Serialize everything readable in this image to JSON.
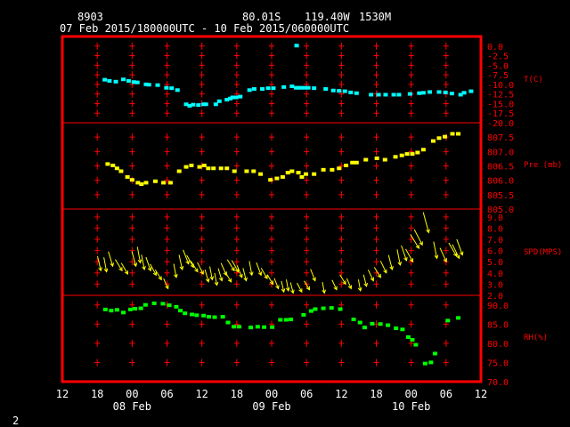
{
  "header": {
    "station": "8903",
    "lat": "80.01S",
    "lon": "119.40W",
    "elev": "1530M",
    "period": "07 Feb 2015/180000UTC - 10 Feb 2015/060000UTC"
  },
  "footer": {
    "page": "2"
  },
  "colors": {
    "frame": "#ff0000",
    "temp": "#00ffff",
    "pres": "#ffff00",
    "wind": "#ffff00",
    "rh": "#00ff00",
    "text": "#ffffff"
  },
  "chart_data": {
    "type": "scatter",
    "x_axis": {
      "unit": "hours since 08 Feb 00 UTC",
      "range": [
        -12,
        60
      ],
      "ticks": [
        -12,
        -6,
        0,
        6,
        12,
        18,
        24,
        30,
        36,
        42,
        48,
        54,
        60
      ],
      "tick_labels": [
        "12",
        "18",
        "00",
        "06",
        "12",
        "18",
        "00",
        "06",
        "12",
        "18",
        "00",
        "06",
        "12"
      ],
      "date_labels": [
        {
          "at": 0,
          "text": "08 Feb"
        },
        {
          "at": 24,
          "text": "09 Feb"
        },
        {
          "at": 48,
          "text": "10 Feb"
        }
      ]
    },
    "panels": [
      {
        "name": "T(C)",
        "type": "scatter",
        "range": [
          -20,
          2.5
        ],
        "ticks": [
          0,
          -2.5,
          -5,
          -7.5,
          -10,
          -12.5,
          -15,
          -17.5,
          -20
        ],
        "tick_labels": [
          "0.0",
          "-2.5",
          "-5.0",
          "-7.5",
          "-10.0",
          "-12.5",
          "-15.0",
          "-17.5",
          "-20.0"
        ],
        "points": [
          [
            -4.7,
            -8.9
          ],
          [
            -3.9,
            -9.2
          ],
          [
            -2.8,
            -9.4
          ],
          [
            -1.5,
            -8.8
          ],
          [
            -0.6,
            -9.2
          ],
          [
            0.3,
            -9.5
          ],
          [
            0.9,
            -9.6
          ],
          [
            2.4,
            -10.1
          ],
          [
            2.9,
            -10.2
          ],
          [
            4.4,
            -10.3
          ],
          [
            5.9,
            -11.0
          ],
          [
            6.8,
            -11.1
          ],
          [
            7.8,
            -11.6
          ],
          [
            9.3,
            -15.3
          ],
          [
            9.9,
            -15.7
          ],
          [
            10.5,
            -15.4
          ],
          [
            11.4,
            -15.5
          ],
          [
            12.3,
            -15.3
          ],
          [
            12.7,
            -15.3
          ],
          [
            14.4,
            -15.3
          ],
          [
            15.0,
            -14.5
          ],
          [
            16.3,
            -14.1
          ],
          [
            16.9,
            -13.8
          ],
          [
            17.3,
            -13.5
          ],
          [
            17.9,
            -13.5
          ],
          [
            18.6,
            -13.3
          ],
          [
            20.2,
            -11.6
          ],
          [
            21.0,
            -11.3
          ],
          [
            22.4,
            -11.3
          ],
          [
            23.4,
            -11.1
          ],
          [
            24.3,
            -11.1
          ],
          [
            26.1,
            -10.8
          ],
          [
            27.5,
            -10.6
          ],
          [
            28.2,
            -11.0
          ],
          [
            28.6,
            -11.0
          ],
          [
            29.1,
            -11.0
          ],
          [
            29.7,
            -11.0
          ],
          [
            30.3,
            -11.0
          ],
          [
            31.3,
            -11.1
          ],
          [
            33.3,
            -11.3
          ],
          [
            34.6,
            -11.7
          ],
          [
            35.6,
            -11.8
          ],
          [
            36.6,
            -11.9
          ],
          [
            37.6,
            -12.2
          ],
          [
            38.6,
            -12.4
          ],
          [
            41.1,
            -12.8
          ],
          [
            42.4,
            -12.8
          ],
          [
            43.6,
            -12.8
          ],
          [
            45.0,
            -12.8
          ],
          [
            45.9,
            -12.8
          ],
          [
            47.8,
            -12.6
          ],
          [
            49.4,
            -12.4
          ],
          [
            50.1,
            -12.3
          ],
          [
            51.2,
            -12.1
          ],
          [
            52.8,
            -12.1
          ],
          [
            53.9,
            -12.2
          ],
          [
            55.0,
            -12.5
          ],
          [
            56.5,
            -12.8
          ],
          [
            57.1,
            -12.3
          ],
          [
            58.3,
            -11.9
          ],
          [
            28.3,
            0.0
          ]
        ]
      },
      {
        "name": "Pre (mb)",
        "type": "scatter",
        "range": [
          805,
          808
        ],
        "ticks": [
          807.5,
          807,
          806.5,
          806,
          805.5,
          805
        ],
        "tick_labels": [
          "807.5",
          "807.0",
          "806.5",
          "806.0",
          "805.5",
          "805.0"
        ],
        "points": [
          [
            -4.2,
            806.55
          ],
          [
            -3.3,
            806.5
          ],
          [
            -2.6,
            806.4
          ],
          [
            -1.9,
            806.3
          ],
          [
            -0.8,
            806.1
          ],
          [
            0.0,
            806.0
          ],
          [
            1.0,
            805.9
          ],
          [
            1.6,
            805.85
          ],
          [
            2.4,
            805.9
          ],
          [
            4.0,
            805.95
          ],
          [
            5.4,
            805.9
          ],
          [
            6.6,
            805.9
          ],
          [
            8.1,
            806.3
          ],
          [
            9.3,
            806.45
          ],
          [
            10.2,
            806.5
          ],
          [
            11.6,
            806.45
          ],
          [
            12.4,
            806.5
          ],
          [
            13.1,
            806.4
          ],
          [
            14.0,
            806.4
          ],
          [
            15.3,
            806.4
          ],
          [
            16.3,
            806.4
          ],
          [
            17.6,
            806.3
          ],
          [
            19.7,
            806.3
          ],
          [
            20.9,
            806.3
          ],
          [
            22.1,
            806.2
          ],
          [
            23.8,
            806.0
          ],
          [
            24.9,
            806.05
          ],
          [
            25.9,
            806.1
          ],
          [
            26.8,
            806.25
          ],
          [
            27.5,
            806.3
          ],
          [
            28.6,
            806.25
          ],
          [
            29.2,
            806.1
          ],
          [
            29.9,
            806.2
          ],
          [
            31.3,
            806.2
          ],
          [
            32.9,
            806.35
          ],
          [
            34.4,
            806.35
          ],
          [
            35.6,
            806.4
          ],
          [
            36.8,
            806.5
          ],
          [
            37.9,
            806.6
          ],
          [
            38.6,
            806.6
          ],
          [
            40.2,
            806.7
          ],
          [
            42.1,
            806.75
          ],
          [
            43.5,
            806.7
          ],
          [
            45.3,
            806.8
          ],
          [
            46.4,
            806.85
          ],
          [
            47.3,
            806.9
          ],
          [
            48.2,
            806.9
          ],
          [
            49.1,
            806.95
          ],
          [
            50.1,
            807.05
          ],
          [
            51.8,
            807.35
          ],
          [
            52.8,
            807.45
          ],
          [
            53.8,
            807.5
          ],
          [
            55.1,
            807.6
          ],
          [
            56.1,
            807.6
          ]
        ]
      },
      {
        "name": "SPD(MPS)",
        "type": "wind_arrows",
        "range": [
          2,
          9.7
        ],
        "ticks": [
          9,
          8,
          7,
          6,
          5,
          4,
          3,
          2
        ],
        "tick_labels": [
          "9.0",
          "8.0",
          "7.0",
          "6.0",
          "5.0",
          "4.0",
          "3.0",
          "2.0"
        ],
        "points": [
          [
            -5.5,
            4.2
          ],
          [
            -4.5,
            4.1
          ],
          [
            -3.5,
            4.6
          ],
          [
            -2.0,
            4.2
          ],
          [
            -1.0,
            3.9
          ],
          [
            0.5,
            4.6
          ],
          [
            1.3,
            4.9
          ],
          [
            2.0,
            4.3
          ],
          [
            3.0,
            4.2
          ],
          [
            3.9,
            3.8
          ],
          [
            4.8,
            3.4
          ],
          [
            6.0,
            2.6
          ],
          [
            7.5,
            3.6
          ],
          [
            8.5,
            4.3
          ],
          [
            9.5,
            4.8
          ],
          [
            10.3,
            4.5
          ],
          [
            11.0,
            4.1
          ],
          [
            12.0,
            3.9
          ],
          [
            13.0,
            3.2
          ],
          [
            13.7,
            3.4
          ],
          [
            14.5,
            2.9
          ],
          [
            15.3,
            3.3
          ],
          [
            16.0,
            3.8
          ],
          [
            16.8,
            3.2
          ],
          [
            17.3,
            4.2
          ],
          [
            18.0,
            4.1
          ],
          [
            18.7,
            3.6
          ],
          [
            19.5,
            3.3
          ],
          [
            20.5,
            3.8
          ],
          [
            22.0,
            3.8
          ],
          [
            23.0,
            3.5
          ],
          [
            24.0,
            3.0
          ],
          [
            25.0,
            2.6
          ],
          [
            26.0,
            2.3
          ],
          [
            26.8,
            2.4
          ],
          [
            27.6,
            2.2
          ],
          [
            29.0,
            2.3
          ],
          [
            30.3,
            2.5
          ],
          [
            31.3,
            3.3
          ],
          [
            33.0,
            2.2
          ],
          [
            35.0,
            2.5
          ],
          [
            36.5,
            3.0
          ],
          [
            37.5,
            2.6
          ],
          [
            39.2,
            2.4
          ],
          [
            40.2,
            2.8
          ],
          [
            41.3,
            3.3
          ],
          [
            42.5,
            3.6
          ],
          [
            43.5,
            4.0
          ],
          [
            44.6,
            4.3
          ],
          [
            46.0,
            4.7
          ],
          [
            47.0,
            5.1
          ],
          [
            48.0,
            5.0
          ],
          [
            49.0,
            6.2
          ],
          [
            49.6,
            6.5
          ],
          [
            50.8,
            7.6
          ],
          [
            52.3,
            5.3
          ],
          [
            53.8,
            5.0
          ],
          [
            55.5,
            5.5
          ],
          [
            56.0,
            5.3
          ],
          [
            56.6,
            5.6
          ]
        ]
      },
      {
        "name": "RH(%)",
        "type": "scatter",
        "range": [
          70,
          92.5
        ],
        "ticks": [
          90,
          85,
          80,
          75,
          70
        ],
        "tick_labels": [
          "90.0",
          "85.0",
          "80.0",
          "75.0",
          "70.0"
        ],
        "points": [
          [
            -4.6,
            88.7
          ],
          [
            -3.6,
            88.4
          ],
          [
            -2.6,
            88.6
          ],
          [
            -1.5,
            87.9
          ],
          [
            -0.3,
            88.7
          ],
          [
            0.5,
            88.9
          ],
          [
            1.5,
            89.0
          ],
          [
            2.3,
            89.9
          ],
          [
            3.8,
            90.3
          ],
          [
            5.3,
            90.2
          ],
          [
            6.4,
            89.8
          ],
          [
            7.6,
            89.4
          ],
          [
            8.3,
            88.4
          ],
          [
            9.1,
            87.7
          ],
          [
            10.3,
            87.4
          ],
          [
            11.1,
            87.2
          ],
          [
            12.3,
            87.1
          ],
          [
            13.2,
            86.8
          ],
          [
            14.2,
            86.7
          ],
          [
            15.6,
            86.8
          ],
          [
            16.5,
            85.3
          ],
          [
            17.5,
            84.2
          ],
          [
            18.4,
            84.2
          ],
          [
            20.4,
            84.0
          ],
          [
            21.6,
            84.2
          ],
          [
            22.7,
            84.1
          ],
          [
            24.1,
            84.1
          ],
          [
            25.5,
            86.0
          ],
          [
            26.5,
            86.0
          ],
          [
            27.3,
            86.1
          ],
          [
            29.5,
            87.3
          ],
          [
            30.8,
            88.3
          ],
          [
            31.5,
            88.8
          ],
          [
            32.9,
            89.0
          ],
          [
            34.3,
            89.1
          ],
          [
            35.8,
            88.8
          ],
          [
            38.1,
            86.1
          ],
          [
            39.2,
            85.3
          ],
          [
            40.0,
            84.0
          ],
          [
            41.3,
            85.0
          ],
          [
            42.7,
            84.9
          ],
          [
            44.0,
            84.6
          ],
          [
            45.4,
            83.8
          ],
          [
            46.5,
            83.5
          ],
          [
            47.5,
            81.5
          ],
          [
            48.2,
            80.8
          ],
          [
            48.8,
            79.5
          ],
          [
            50.4,
            74.6
          ],
          [
            51.4,
            74.9
          ],
          [
            52.1,
            77.2
          ],
          [
            54.3,
            85.8
          ],
          [
            56.1,
            86.5
          ]
        ]
      }
    ]
  }
}
